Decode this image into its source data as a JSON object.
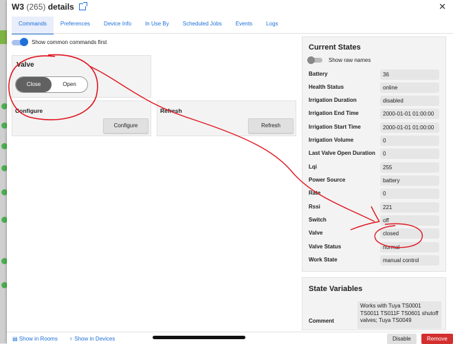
{
  "title": {
    "device": "W3",
    "count": "(265)",
    "suffix": "details"
  },
  "close_label": "✕",
  "tabs": [
    "Commands",
    "Preferences",
    "Device Info",
    "In Use By",
    "Scheduled Jobs",
    "Events",
    "Logs"
  ],
  "common_toggle_label": "Show common commands first",
  "valve_card": {
    "title": "Valve",
    "close_label": "Close",
    "open_label": "Open",
    "selected": "Close"
  },
  "configure_card": {
    "title": "Configure",
    "button": "Configure"
  },
  "refresh_card": {
    "title": "Refresh",
    "button": "Refresh"
  },
  "current_states": {
    "title": "Current States",
    "raw_names_label": "Show raw names",
    "rows": [
      {
        "name": "Battery",
        "value": "36"
      },
      {
        "name": "Health Status",
        "value": "online"
      },
      {
        "name": "Irrigation Duration",
        "value": "disabled"
      },
      {
        "name": "Irrigation End Time",
        "value": "2000-01-01 01:00:00"
      },
      {
        "name": "Irrigation Start Time",
        "value": "2000-01-01 01:00:00"
      },
      {
        "name": "Irrigation Volume",
        "value": "0"
      },
      {
        "name": "Last Valve Open Duration",
        "value": "0"
      },
      {
        "name": "Lqi",
        "value": "255"
      },
      {
        "name": "Power Source",
        "value": "battery"
      },
      {
        "name": "Rate",
        "value": "0"
      },
      {
        "name": "Rssi",
        "value": "221"
      },
      {
        "name": "Switch",
        "value": "off"
      },
      {
        "name": "Valve",
        "value": "closed"
      },
      {
        "name": "Valve Status",
        "value": "normal"
      },
      {
        "name": "Work State",
        "value": "manual control"
      }
    ]
  },
  "state_variables": {
    "title": "State Variables",
    "key": "Comment",
    "value": "Works with Tuya TS0001 TS0011 TS011F TS0601 shutoff valves; Tuya TS0049"
  },
  "footer": {
    "show_in_rooms": "Show in Rooms",
    "show_in_devices": "Show in Devices",
    "disable": "Disable",
    "remove": "Remove"
  },
  "colors": {
    "accent": "#1e6fd9",
    "annotation": "#e0141e",
    "remove": "#d32f2f"
  }
}
